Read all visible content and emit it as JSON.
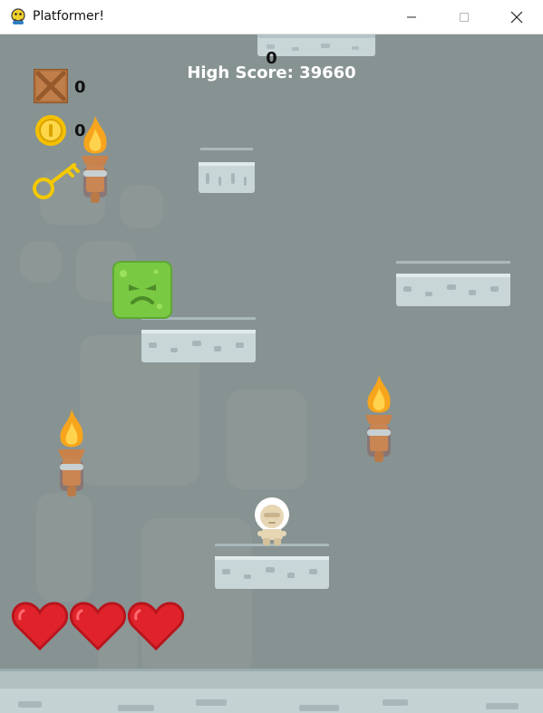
{
  "window": {
    "title": "Platformer!",
    "app_icon": "python-snake-icon",
    "controls": [
      "minimize-icon",
      "maximize-icon",
      "close-icon"
    ]
  },
  "hud": {
    "current_score": "0",
    "high_score": "High Score: 39660",
    "crates_count": "0",
    "coins_count": "0",
    "has_key": true,
    "lives": 3
  },
  "colors": {
    "background": "#879392",
    "platform": "#c9d6d8",
    "slime": "#7ac943",
    "heart": "#e0232b",
    "key": "#f5c800",
    "flame": "#f7a51c"
  }
}
